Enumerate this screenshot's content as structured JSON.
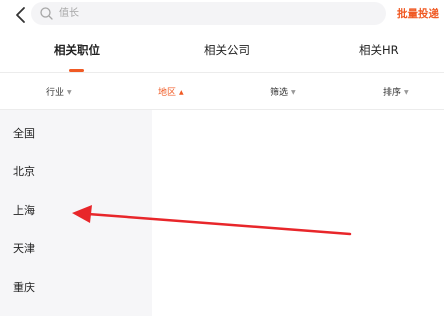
{
  "header": {
    "back_icon": "chevron-left-icon",
    "search": {
      "placeholder": "值长",
      "icon": "search-icon"
    },
    "batch_label": "批量投递"
  },
  "tabs": [
    {
      "label": "相关职位",
      "active": true
    },
    {
      "label": "相关公司",
      "active": false
    },
    {
      "label": "相关HR",
      "active": false
    }
  ],
  "filters": [
    {
      "label": "行业",
      "active": false
    },
    {
      "label": "地区",
      "active": true
    },
    {
      "label": "筛选",
      "active": false
    },
    {
      "label": "排序",
      "active": false
    }
  ],
  "regions": [
    "全国",
    "北京",
    "上海",
    "天津",
    "重庆"
  ],
  "colors": {
    "accent": "#f05a24",
    "annotation_arrow": "#e8262a"
  }
}
